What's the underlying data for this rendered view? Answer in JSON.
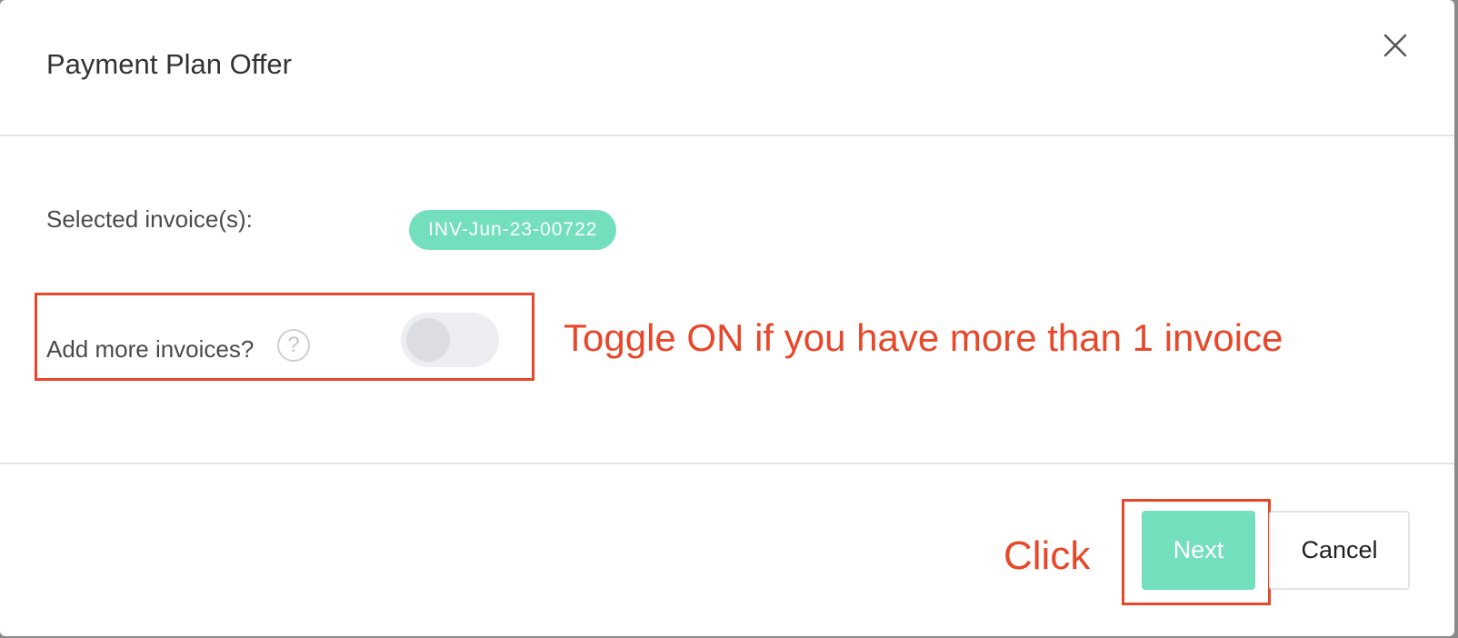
{
  "modal": {
    "title": "Payment Plan Offer",
    "close_icon": "close-icon"
  },
  "selected_invoices": {
    "label": "Selected invoice(s):",
    "items": [
      "INV-Jun-23-00722"
    ],
    "badge_color": "#74dfbd"
  },
  "add_more": {
    "label": "Add more invoices?",
    "help_icon": "?",
    "toggle_on": false
  },
  "annotations": {
    "toggle_hint": "Toggle ON if you have more than 1 invoice",
    "click_hint": "Click",
    "color": "#e8472a"
  },
  "footer": {
    "next_label": "Next",
    "cancel_label": "Cancel",
    "accent_color": "#74dfbd"
  }
}
